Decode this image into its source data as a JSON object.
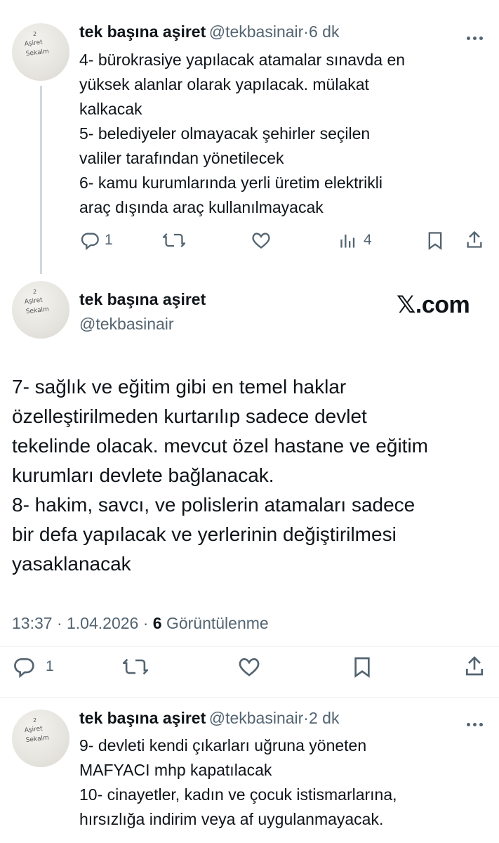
{
  "tweets": [
    {
      "name": "tek başına aşiret",
      "handle": "@tekbasinair",
      "separator": "·",
      "time": "6 dk",
      "lines": [
        "4- bürokrasiye yapılacak atamalar sınavda en",
        "yüksek alanlar olarak yapılacak. mülakat",
        "kalkacak",
        "5- belediyeler olmayacak şehirler seçilen",
        "valiler tarafından yönetilecek",
        "6- kamu kurumlarında yerli üretim elektrikli",
        "araç dışında araç kullanılmayacak"
      ],
      "reply_count": "1",
      "views_count": "4"
    },
    {
      "name": "tek başına aşiret",
      "handle": "@tekbasinair",
      "brand": "𝕏.com",
      "lines": [
        "7- sağlık ve eğitim gibi en temel haklar",
        "özelleştirilmeden kurtarılıp sadece devlet",
        "tekelinde olacak. mevcut özel hastane ve eğitim",
        "kurumları devlete bağlanacak.",
        "8- hakim, savcı, ve polislerin atamaları sadece",
        "bir defa yapılacak ve yerlerinin değiştirilmesi",
        "yasaklanacak"
      ],
      "timestamp": "13:37 · 1.04.2026 ·",
      "views_count": "6",
      "views_label": "Görüntülenme",
      "reply_count": "1"
    },
    {
      "name": "tek başına aşiret",
      "handle": "@tekbasinair",
      "separator": "·",
      "time": "2 dk",
      "lines": [
        "9- devleti kendi çıkarları uğruna yöneten",
        "MAFYACI mhp kapatılacak",
        "10- cinayetler, kadın ve çocuk istismarlarına,",
        "hırsızlığa indirim veya af uygulanmayacak."
      ]
    }
  ],
  "avatar_scribble": [
    "2",
    "Aşiret",
    "Sekalm"
  ],
  "icons": [
    "reply-icon",
    "retweet-icon",
    "like-icon",
    "views-icon",
    "bookmark-icon",
    "share-icon",
    "more-icon"
  ]
}
